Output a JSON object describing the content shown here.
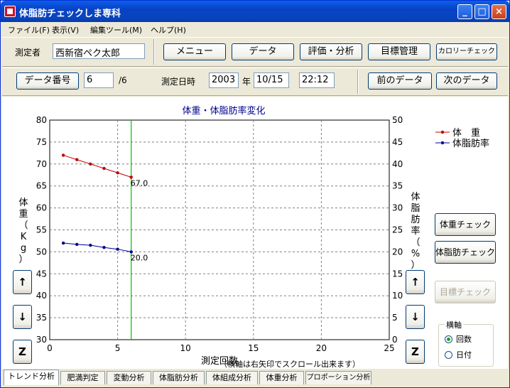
{
  "window": {
    "title": "体脂肪チェックしま専科"
  },
  "menu": [
    "ファイル(F)",
    "表示(V)",
    "編集ツール(M)",
    "ヘルプ(H)"
  ],
  "toolbar": {
    "person_label": "測定者",
    "person_name": "西新宿ペク太郎",
    "buttons": [
      "メニュー",
      "データ",
      "評価・分析",
      "目標管理",
      "カロリーチェック"
    ]
  },
  "record": {
    "data_no_button": "データ番号",
    "data_no": "6",
    "data_total": "/6",
    "date_label": "測定日時",
    "year": "2003",
    "year_unit": "年",
    "date": "10/15",
    "time": "22:12",
    "prev_button": "前のデータ",
    "next_button": "次のデータ"
  },
  "chart_data": {
    "type": "line",
    "title": "体重・体脂肪率変化",
    "xlabel": "測定回数",
    "xnote": "（横軸は右矢印でスクロール出来ます）",
    "ylabel_left": "体重（Kg）",
    "ylabel_right": "体脂肪率（%）",
    "x": [
      1,
      2,
      3,
      4,
      5,
      6
    ],
    "xlim": [
      0,
      25
    ],
    "xticks": [
      0,
      5,
      10,
      15,
      20,
      25
    ],
    "ylim_left": [
      30,
      80
    ],
    "yticks_left": [
      30,
      35,
      40,
      45,
      50,
      55,
      60,
      65,
      70,
      75,
      80
    ],
    "ylim_right": [
      0,
      50
    ],
    "yticks_right": [
      0,
      5,
      10,
      15,
      20,
      25,
      30,
      35,
      40,
      45,
      50
    ],
    "series": [
      {
        "name": "体　重",
        "axis": "left",
        "color": "#C00000",
        "values": [
          72.0,
          71.0,
          70.0,
          69.0,
          68.0,
          67.0
        ]
      },
      {
        "name": "体脂肪率",
        "axis": "right",
        "color": "#000090",
        "values": [
          22.0,
          21.7,
          21.5,
          21.0,
          20.6,
          20.0
        ]
      }
    ],
    "marker_x": 6,
    "marker_color": "#00C000",
    "annotations": [
      "67.0",
      "20.0"
    ],
    "grid": true,
    "legend": "top-right"
  },
  "side": {
    "weight_check": "体重チェック",
    "fat_check": "体脂肪チェック",
    "goal_check": "目標チェック",
    "axis_group": "横軸",
    "axis_options": [
      "回数",
      "日付"
    ],
    "axis_selected": "回数"
  },
  "scroll_buttons": {
    "up": "↑",
    "down": "↓",
    "zoom": "Z"
  },
  "tabs": [
    "トレンド分析",
    "肥満判定",
    "変動分析",
    "体脂肪分析",
    "体組成分析",
    "体重分析",
    "プロポーション分析"
  ]
}
